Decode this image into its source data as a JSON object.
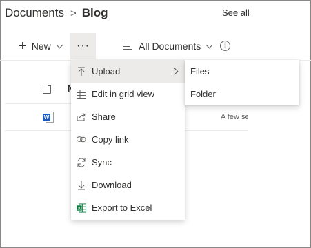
{
  "breadcrumb": {
    "root": "Documents",
    "separator": ">",
    "current": "Blog"
  },
  "header": {
    "see_all": "See all"
  },
  "toolbar": {
    "new_label": "New",
    "more_label": "···",
    "view_label": "All Documents"
  },
  "list": {
    "header_partial": "N",
    "rows": [
      {
        "icon": "word-doc-icon",
        "icon_badge": "W",
        "modified": "A few se"
      }
    ]
  },
  "menu": {
    "items": [
      {
        "label": "Upload",
        "icon": "upload-icon",
        "active": true,
        "has_submenu": true
      },
      {
        "label": "Edit in grid view",
        "icon": "grid-icon"
      },
      {
        "label": "Share",
        "icon": "share-icon"
      },
      {
        "label": "Copy link",
        "icon": "link-icon"
      },
      {
        "label": "Sync",
        "icon": "sync-icon"
      },
      {
        "label": "Download",
        "icon": "download-icon"
      },
      {
        "label": "Export to Excel",
        "icon": "excel-icon"
      }
    ]
  },
  "submenu": {
    "items": [
      {
        "label": "Files"
      },
      {
        "label": "Folder"
      }
    ]
  },
  "colors": {
    "border": "#8a8886",
    "hover": "#edebe9",
    "text": "#323130",
    "word": "#185abd",
    "excel": "#107c41"
  }
}
